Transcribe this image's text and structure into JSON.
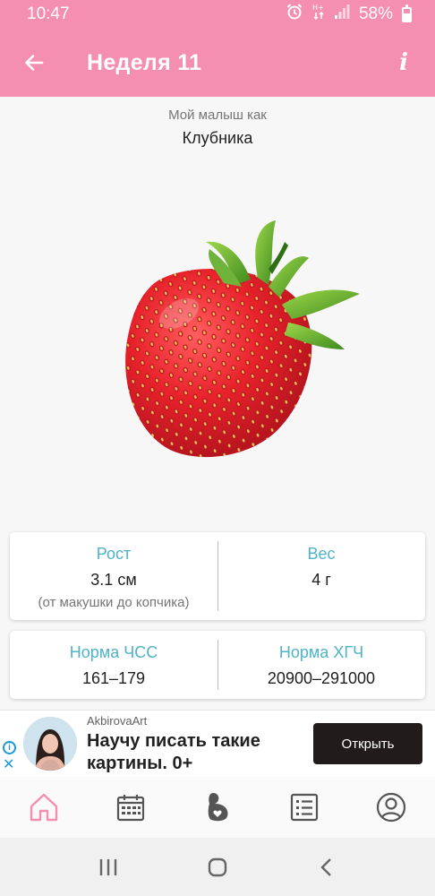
{
  "status": {
    "time": "10:47",
    "battery": "58%",
    "icons": [
      "alarm-icon",
      "data-transfer-icon",
      "signal-icon",
      "battery-icon"
    ]
  },
  "appbar": {
    "title": "Неделя 11",
    "back_icon": "arrow-back-icon",
    "info_label": "i"
  },
  "content": {
    "subtitle": "Мой малыш как",
    "fruit": "Клубника",
    "fruit_image": "strawberry"
  },
  "stats": {
    "height": {
      "label": "Рост",
      "value": "3.1 см",
      "note": "(от макушки до копчика)"
    },
    "weight": {
      "label": "Вес",
      "value": "4 г"
    },
    "hr": {
      "label": "Норма ЧСС",
      "value": "161–179"
    },
    "hcg": {
      "label": "Норма ХГЧ",
      "value": "20900–291000"
    }
  },
  "ad": {
    "advertiser": "AkbirovaArt",
    "headline": "Научу писать такие картины. 0+",
    "cta": "Открыть"
  },
  "bottom_nav": {
    "items": [
      "home-icon",
      "calendar-icon",
      "pregnancy-icon",
      "list-icon",
      "profile-icon"
    ],
    "active": "home-icon"
  },
  "colors": {
    "primary": "#f48fb1",
    "accent_label": "#4fb3c7",
    "ad_button": "#221b1b"
  }
}
